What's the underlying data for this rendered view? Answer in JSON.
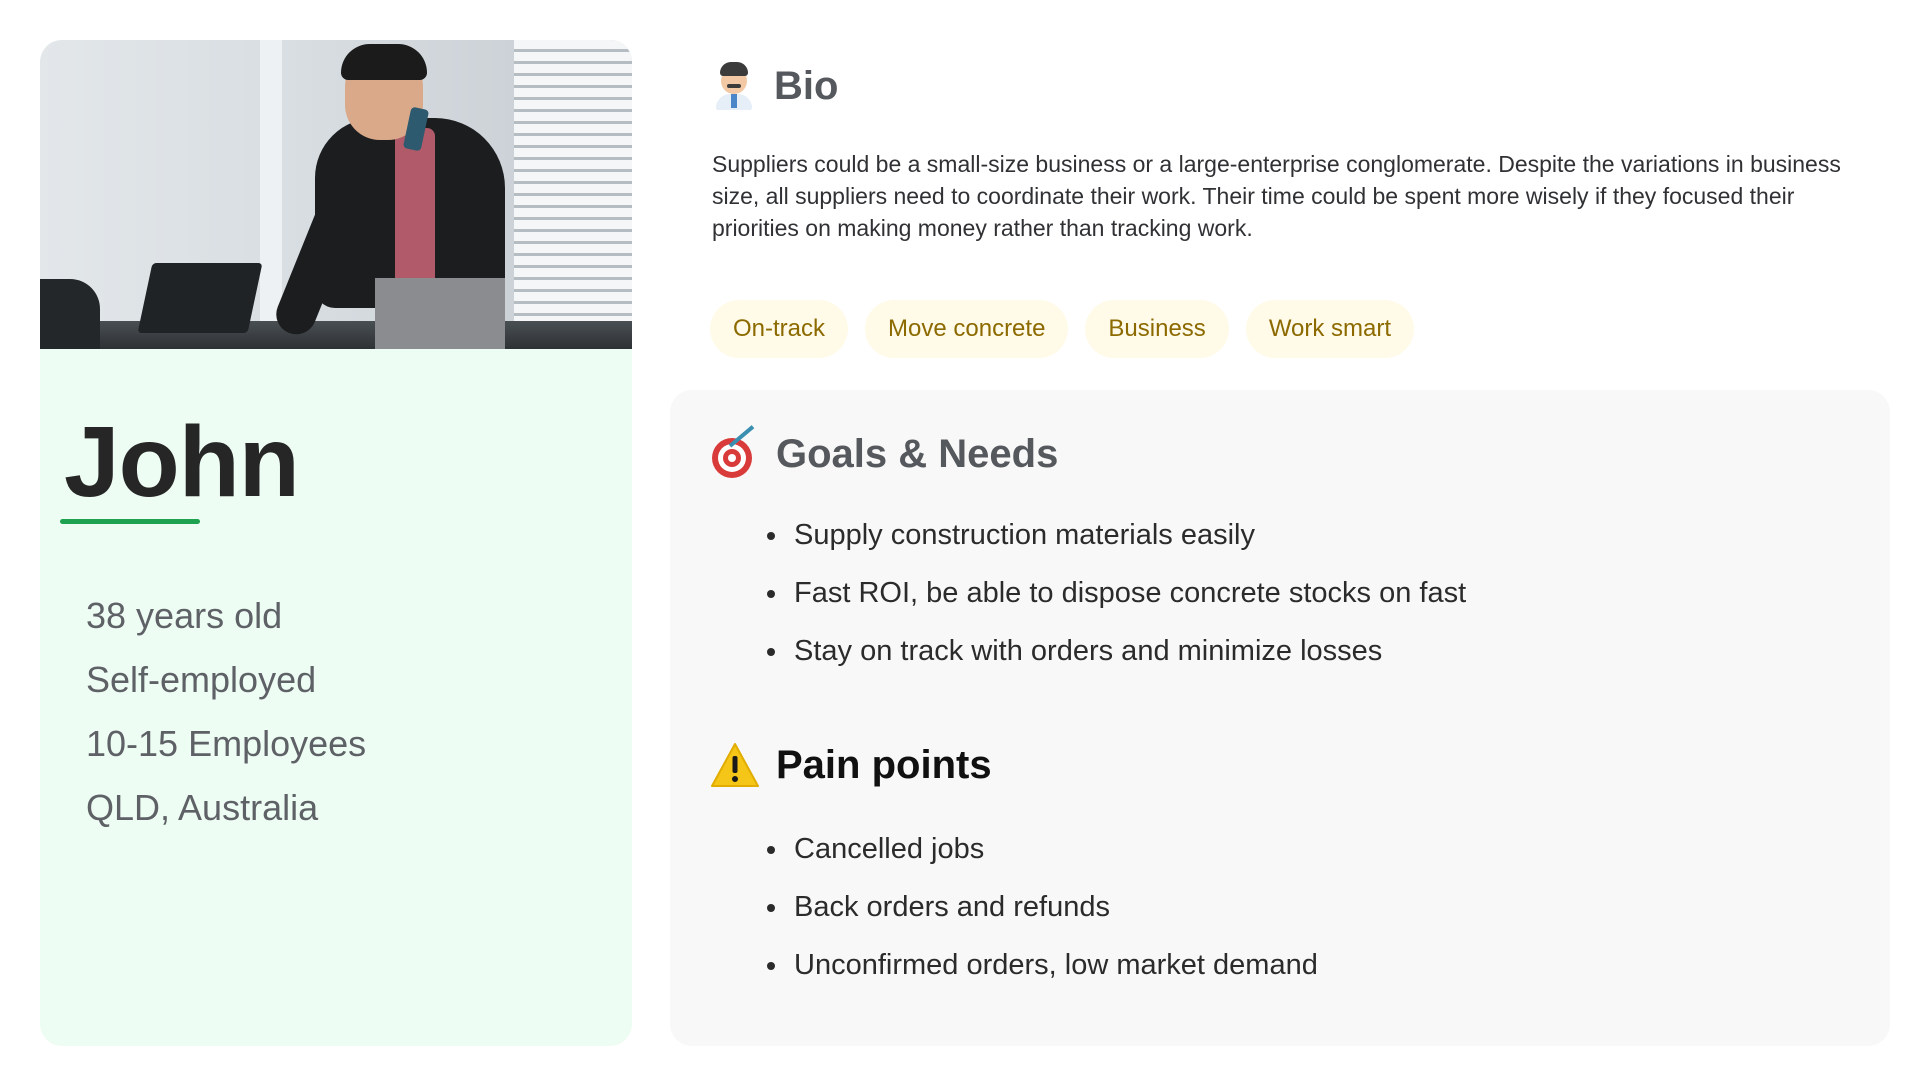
{
  "profile": {
    "name": "John",
    "facts": [
      "38 years old",
      "Self-employed",
      "10-15 Employees",
      "QLD, Australia"
    ],
    "accent_color": "#1fa24f",
    "card_color": "#eefdf3"
  },
  "bio": {
    "title": "Bio",
    "icon": "businessman-icon",
    "text": "Suppliers could be a small-size business or a large-enterprise conglomerate. Despite the variations in business size, all suppliers need to coordinate their work. Their time could be spent more wisely if they focused their priorities on making money rather than tracking work.",
    "tags": [
      "On-track",
      "Move concrete",
      "Business",
      "Work smart"
    ],
    "tag_color": "#8c6a00",
    "tag_background": "#fffbe8"
  },
  "goals": {
    "title": "Goals & Needs",
    "icon": "target-icon",
    "items": [
      "Supply construction materials easily",
      "Fast ROI, be able to dispose concrete stocks on fast",
      "Stay on track with orders and minimize losses"
    ]
  },
  "pain_points": {
    "title": "Pain points",
    "icon": "warning-icon",
    "items": [
      "Cancelled jobs",
      "Back orders and refunds",
      "Unconfirmed orders, low market demand"
    ]
  }
}
